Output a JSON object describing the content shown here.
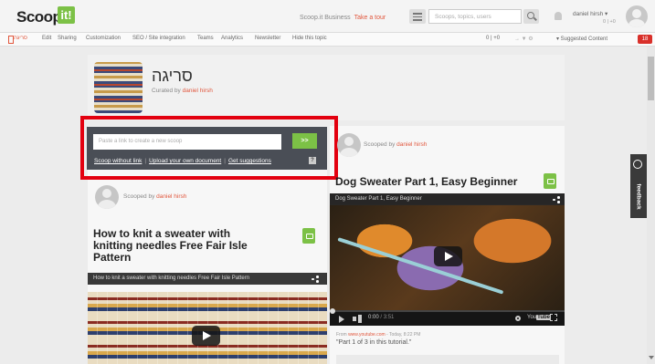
{
  "app": {
    "logo": "Scoop.",
    "logo_mark": "it!",
    "business_text": "Scoop.it Business",
    "tour_link": "Take a tour",
    "search_placeholder": "Scoops, topics, users",
    "user_name": "daniel hirsh ▾",
    "user_score": "0 | +0"
  },
  "subnav": {
    "tabs": [
      "סריגה",
      "Edit",
      "Sharing",
      "Customization",
      "SEO / Site integration",
      "Teams",
      "Analytics",
      "Newsletter",
      "Hide this topic"
    ],
    "stats": "0 | +0",
    "suggested": "▾ Suggested Content",
    "suggested_count": "18"
  },
  "topic": {
    "title": "סריגה",
    "curated_by": "Curated by",
    "curator": "daniel hirsh"
  },
  "new_scoop": {
    "placeholder": "Paste a link to create a new scoop",
    "go": ">>",
    "links": [
      "Scoop without link",
      "Upload your own document",
      "Get suggestions"
    ],
    "help": "?"
  },
  "left_post": {
    "scooped_by": "Scooped by",
    "user": "daniel hirsh",
    "title_lines": [
      "How to knit a sweater with",
      "knitting needles Free Fair Isle",
      "Pattern"
    ],
    "video_title": "How to knit a sweater with knitting needles Free Fair Isle Pattern"
  },
  "right_post": {
    "scooped_by": "Scooped by",
    "user": "daniel hirsh",
    "title": "Dog Sweater Part 1, Easy Beginner",
    "video_title": "Dog Sweater Part 1, Easy Beginner",
    "time": "0:00",
    "duration": "/ 3:51",
    "youtube": "You",
    "youtube_tube": "Tube",
    "from_label": "From",
    "from_source": "www.youtube.com",
    "from_date": "- Today, 8:22 PM",
    "quote": "\"Part 1 of 3 in this tutorial.\""
  },
  "feedback": {
    "label": "feedback"
  },
  "colors": {
    "accent": "#e1573d",
    "green": "#7cc146",
    "highlight": "#e3000f",
    "panel": "#4a4e56"
  },
  "icons": [
    "menu-icon",
    "search-icon",
    "bell-icon",
    "share-icon",
    "play-icon",
    "gear-icon",
    "fullscreen-icon",
    "feedback-icon",
    "repost-icon"
  ]
}
